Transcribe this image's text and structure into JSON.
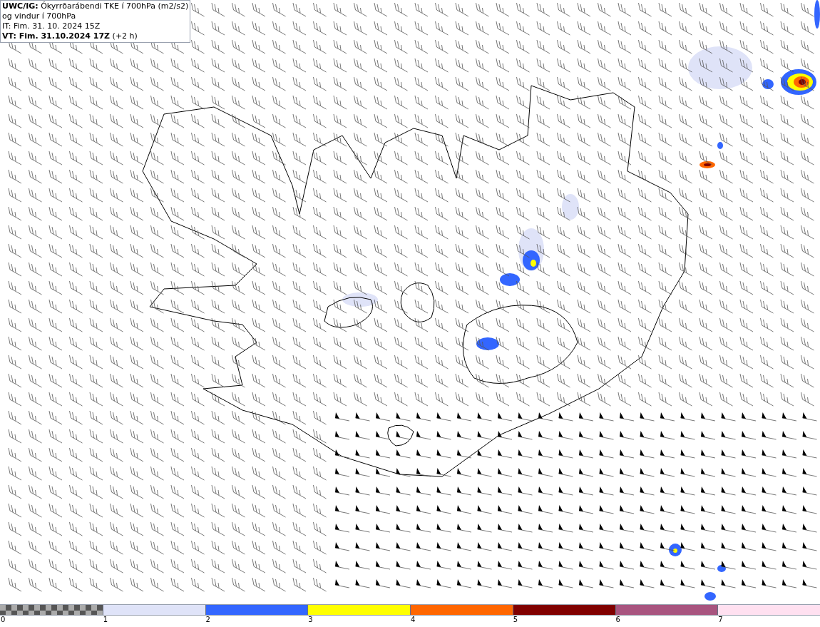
{
  "title": {
    "lines": [
      "**UWC/IG:** Ókyrrðarábendi TKE í 700hPa (m2/s2)",
      "og vindur í 700hPa",
      "IT: Fim. 31. 10. 2024 15Z",
      "**VT: Fim. 31.10.2024 17Z** (+2 h)"
    ]
  },
  "legend": {
    "segments": [
      {
        "kind": "checker"
      },
      {
        "kind": "solid",
        "color": "#dfe3f8"
      },
      {
        "kind": "solid",
        "color": "#3366ff"
      },
      {
        "kind": "solid",
        "color": "#ffff00"
      },
      {
        "kind": "solid",
        "color": "#ff6600"
      },
      {
        "kind": "solid",
        "color": "#800000"
      },
      {
        "kind": "solid",
        "color": "#a8547f"
      },
      {
        "kind": "solid",
        "color": "#ffe0f0"
      }
    ],
    "ticks": [
      "0",
      "1",
      "2",
      "3",
      "4",
      "5",
      "6",
      "7"
    ]
  }
}
